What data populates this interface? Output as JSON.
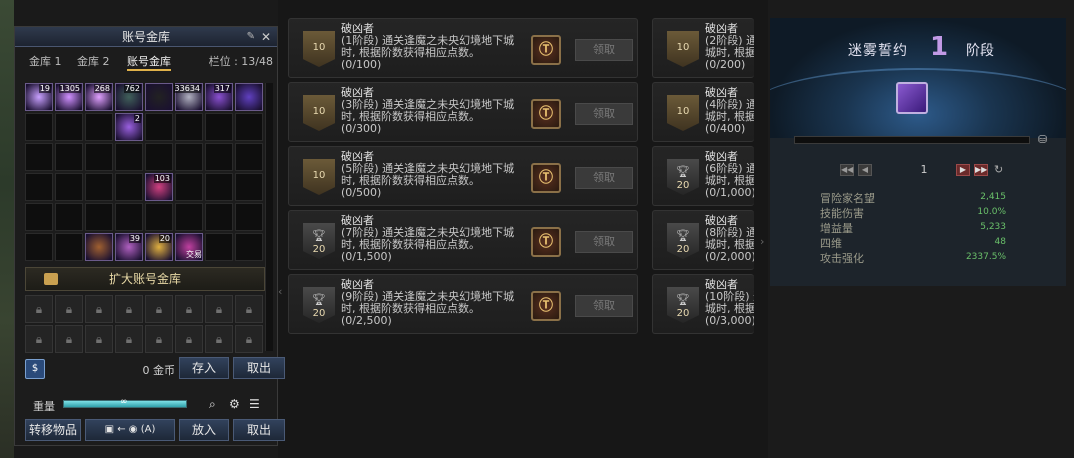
{
  "vault": {
    "title": "账号金库",
    "tabs": [
      "金库 1",
      "金库 2",
      "账号金库"
    ],
    "slots": "栏位 : 13/48",
    "items": [
      {
        "count": "19",
        "color": "#c8a0ff"
      },
      {
        "count": "1305",
        "color": "#d090ff"
      },
      {
        "count": "268",
        "color": "#e0a0ff"
      },
      {
        "count": "762",
        "color": "#40605a"
      },
      {
        "count": "",
        "color": "#222222"
      },
      {
        "count": "33634",
        "color": "#b0b0c0"
      },
      {
        "count": "317",
        "color": "#8a50d0"
      },
      {
        "count": "",
        "color": "#6040c0"
      },
      {
        "count": "2",
        "color": "#9a60e0"
      },
      {
        "count": "103",
        "color": "#d04080"
      },
      {
        "count": "",
        "color": "#a06030"
      },
      {
        "count": "39",
        "color": "#b060c0"
      },
      {
        "count": "20",
        "color": "#e0b040"
      },
      {
        "count": "",
        "color": "#c040a0",
        "trade": "交易"
      }
    ],
    "expand_label": "扩大账号金库",
    "gold_amount": "0 金币",
    "deposit": "存入",
    "withdraw": "取出",
    "weight_label": "重量",
    "weight_value": "∞",
    "transfer": "转移物品",
    "shortcut": "(A)",
    "put_in": "放入",
    "take_out": "取出"
  },
  "achievements": {
    "claim_label": "领取",
    "left": [
      {
        "title": "破凶者",
        "desc": "(1阶段) 通关逢魔之未央幻境地下城时, 根据阶数获得相应点数。",
        "progress": "(0/100)",
        "badge": "10"
      },
      {
        "title": "破凶者",
        "desc": "(3阶段) 通关逢魔之未央幻境地下城时, 根据阶数获得相应点数。",
        "progress": "(0/300)",
        "badge": "10"
      },
      {
        "title": "破凶者",
        "desc": "(5阶段) 通关逢魔之未央幻境地下城时, 根据阶数获得相应点数。",
        "progress": "(0/500)",
        "badge": "10"
      },
      {
        "title": "破凶者",
        "desc": "(7阶段) 通关逢魔之未央幻境地下城时, 根据阶数获得相应点数。",
        "progress": "(0/1,500)",
        "badge": "20"
      },
      {
        "title": "破凶者",
        "desc": "(9阶段) 通关逢魔之未央幻境地下城时, 根据阶数获得相应点数。",
        "progress": "(0/2,500)",
        "badge": "20"
      }
    ],
    "right": [
      {
        "title": "破凶者",
        "desc": "(2阶段) 通",
        "desc2": "城时, 根据",
        "progress": "(0/200)",
        "badge": "10"
      },
      {
        "title": "破凶者",
        "desc": "(4阶段) 通",
        "desc2": "城时, 根据",
        "progress": "(0/400)",
        "badge": "10"
      },
      {
        "title": "破凶者",
        "desc": "(6阶段) 通",
        "desc2": "城时, 根据",
        "progress": "(0/1,000)",
        "badge": "20"
      },
      {
        "title": "破凶者",
        "desc": "(8阶段) 通",
        "desc2": "城时, 根据",
        "progress": "(0/2,000)",
        "badge": "20"
      },
      {
        "title": "破凶者",
        "desc": "(10阶段) 通",
        "desc2": "城时, 根据",
        "progress": "(0/3,000)",
        "badge": "20"
      }
    ]
  },
  "mist": {
    "title": "迷雾誓约",
    "stage_number": "1",
    "stage_label": "阶段",
    "page": "1",
    "stats": [
      {
        "key": "冒险家名望",
        "value": "2,415"
      },
      {
        "key": "技能伤害",
        "value": "10.0%"
      },
      {
        "key": "增益量",
        "value": "5,233"
      },
      {
        "key": "四维",
        "value": "48"
      },
      {
        "key": "攻击强化",
        "value": "2337.5%"
      }
    ]
  },
  "colors": {
    "accent": "#e0b24a",
    "stat_value": "#6ac06a",
    "stage_number": "#c29ae6"
  }
}
